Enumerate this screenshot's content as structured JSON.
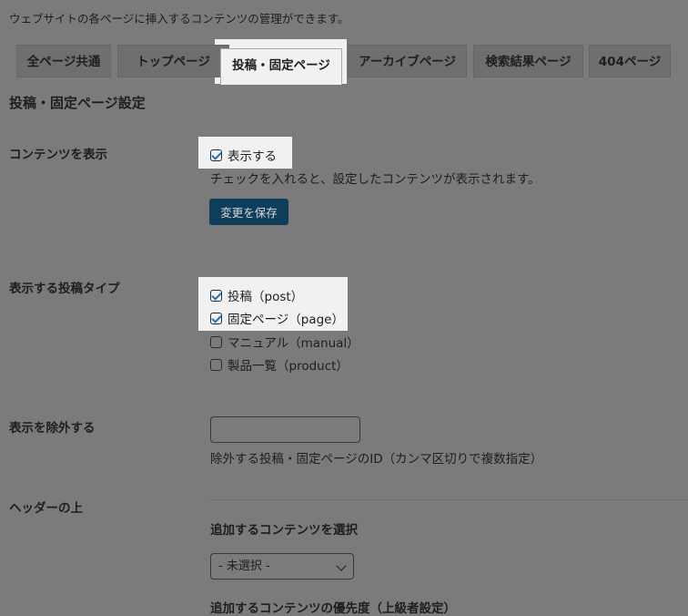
{
  "intro": "ウェブサイトの各ページに挿入するコンテンツの管理ができます。",
  "tabs": [
    {
      "label": "全ページ共通"
    },
    {
      "label": "トップページ"
    },
    {
      "label": "投稿・固定ページ",
      "active": true
    },
    {
      "label": "アーカイブページ"
    },
    {
      "label": "検索結果ページ"
    },
    {
      "label": "404ページ"
    }
  ],
  "section_title": "投稿・固定ページ設定",
  "display": {
    "label": "コンテンツを表示",
    "checkbox_label": "表示する",
    "checked": true,
    "description": "チェックを入れると、設定したコンテンツが表示されます。",
    "save_label": "変更を保存"
  },
  "post_types": {
    "label": "表示する投稿タイプ",
    "items": [
      {
        "label": "投稿（post）",
        "checked": true
      },
      {
        "label": "固定ページ（page）",
        "checked": true
      },
      {
        "label": "マニュアル（manual）",
        "checked": false
      },
      {
        "label": "製品一覧（product）",
        "checked": false
      }
    ]
  },
  "exclude": {
    "label": "表示を除外する",
    "value": "",
    "description": "除外する投稿・固定ページのID（カンマ区切りで複数指定）"
  },
  "header_top": {
    "label": "ヘッダーの上",
    "select_label": "追加するコンテンツを選択",
    "select_value": "- 未選択 -",
    "priority_label": "追加するコンテンツの優先度（上級者設定）"
  },
  "colors": {
    "background": "#7b7b7b",
    "highlight": "#f1f1f1",
    "primary_button": "#0e3e5c",
    "check": "#2271b1"
  },
  "icons": {
    "checkbox_check": "check-icon",
    "select_chevron": "chevron-down-icon"
  }
}
